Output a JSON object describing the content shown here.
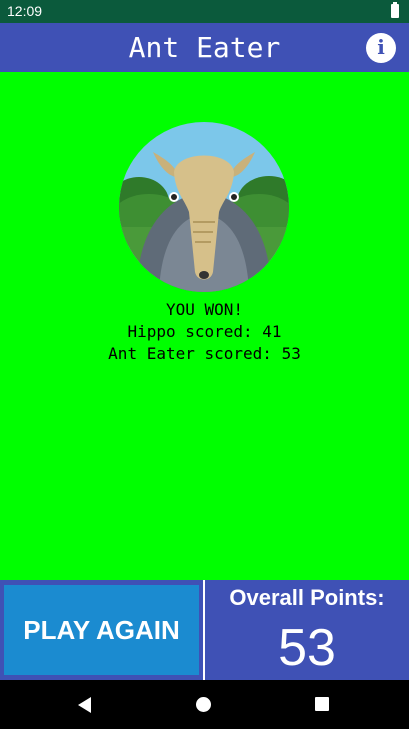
{
  "status_bar": {
    "time": "12:09",
    "icons": [
      "battery-icon"
    ]
  },
  "app_bar": {
    "title": "Ant Eater",
    "info_icon": "info-icon"
  },
  "game": {
    "avatar": "anteater-avatar",
    "result": "YOU WON!",
    "hippo_score_line": "Hippo scored: 41",
    "anteater_score_line": "Ant Eater scored: 53"
  },
  "bottom": {
    "play_again_label": "PLAY AGAIN",
    "overall_points_label": "Overall Points:",
    "overall_points_value": "53"
  },
  "nav": {
    "icons": [
      "back-icon",
      "home-icon",
      "recents-icon"
    ]
  },
  "colors": {
    "status_bar": "#0b5a3c",
    "app_bar": "#3f51b5",
    "game_background": "#00ff00",
    "play_again_button": "#1b8bd0"
  }
}
